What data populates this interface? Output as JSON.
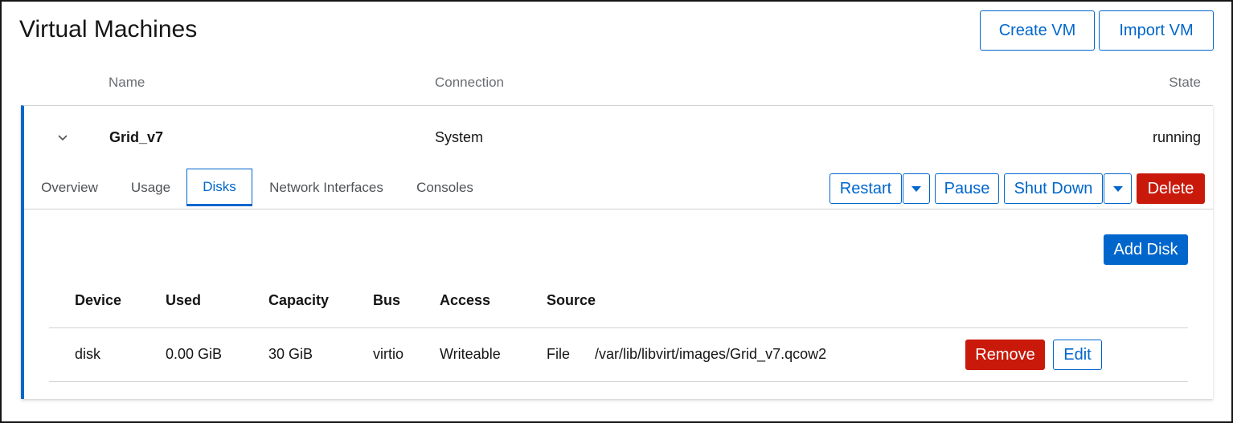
{
  "header": {
    "title": "Virtual Machines",
    "create_label": "Create VM",
    "import_label": "Import VM"
  },
  "columns": {
    "name": "Name",
    "connection": "Connection",
    "state": "State"
  },
  "vm": {
    "name": "Grid_v7",
    "connection": "System",
    "state": "running",
    "tabs": [
      {
        "label": "Overview",
        "active": false
      },
      {
        "label": "Usage",
        "active": false
      },
      {
        "label": "Disks",
        "active": true
      },
      {
        "label": "Network Interfaces",
        "active": false
      },
      {
        "label": "Consoles",
        "active": false
      }
    ],
    "actions": {
      "restart": "Restart",
      "pause": "Pause",
      "shutdown": "Shut Down",
      "delete": "Delete"
    }
  },
  "disks": {
    "add_label": "Add Disk",
    "headers": [
      "Device",
      "Used",
      "Capacity",
      "Bus",
      "Access",
      "Source"
    ],
    "rows": [
      {
        "device": "disk",
        "used": "0.00 GiB",
        "capacity": "30 GiB",
        "bus": "virtio",
        "access": "Writeable",
        "source_type": "File",
        "source_path": "/var/lib/libvirt/images/Grid_v7.qcow2",
        "remove_label": "Remove",
        "edit_label": "Edit"
      }
    ]
  },
  "colors": {
    "accent": "#0066cc",
    "danger": "#c9190b",
    "text": "#151515",
    "muted": "#6a6e73"
  }
}
